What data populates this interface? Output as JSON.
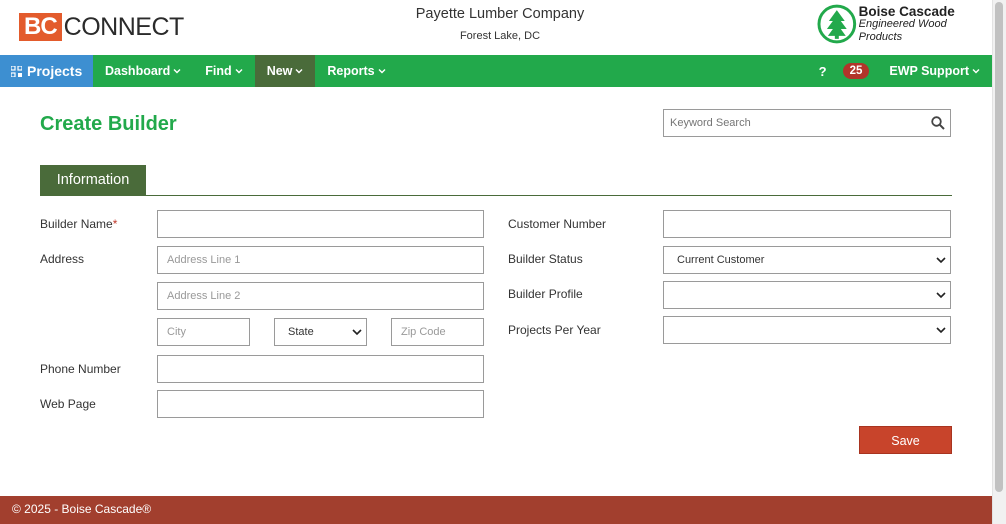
{
  "header": {
    "logo_left_bc": "BC",
    "logo_left_connect": "CONNECT",
    "company_name": "Payette Lumber Company",
    "company_location": "Forest Lake, DC",
    "brand_line1": "Boise Cascade",
    "brand_line2": "Engineered Wood Products"
  },
  "nav": {
    "projects_label": "Projects",
    "items": [
      {
        "label": "Dashboard"
      },
      {
        "label": "Find"
      },
      {
        "label": "New"
      },
      {
        "label": "Reports"
      }
    ],
    "help_label": "?",
    "notification_count": "25",
    "support_label": "EWP Support"
  },
  "page": {
    "title": "Create Builder",
    "search_placeholder": "Keyword Search",
    "tab_label": "Information"
  },
  "form": {
    "builder_name_label": "Builder Name",
    "required_mark": "*",
    "address_label": "Address",
    "address_line1_placeholder": "Address Line 1",
    "address_line2_placeholder": "Address Line 2",
    "city_placeholder": "City",
    "state_value": "State",
    "zip_placeholder": "Zip Code",
    "phone_label": "Phone Number",
    "web_label": "Web Page",
    "customer_number_label": "Customer Number",
    "builder_status_label": "Builder Status",
    "builder_status_value": "Current Customer",
    "builder_profile_label": "Builder Profile",
    "builder_profile_value": "",
    "projects_per_year_label": "Projects Per Year",
    "projects_per_year_value": "",
    "save_label": "Save"
  },
  "footer": {
    "text": "© 2025 - Boise Cascade®"
  },
  "colors": {
    "nav_green": "#22a94b",
    "nav_active": "#4a6b3a",
    "projects_blue": "#3d8fd1",
    "save_red": "#c8442b",
    "footer_red": "#a23f2e",
    "badge_red": "#b2342a",
    "logo_orange": "#e35b2c"
  },
  "icons": {
    "projects": "qr-grid-icon",
    "caret": "chevron-down-icon",
    "search": "magnifier-icon",
    "brand": "tree-icon"
  }
}
